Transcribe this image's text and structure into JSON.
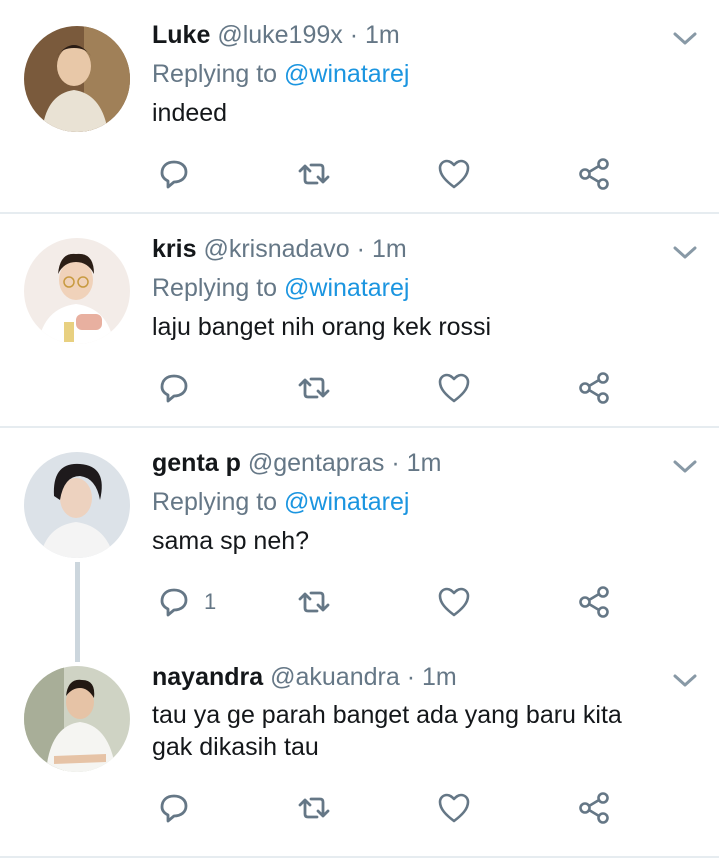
{
  "tweets": [
    {
      "name": "Luke",
      "handle": "@luke199x",
      "time": "1m",
      "replying_prefix": "Replying to",
      "replying_to": "@winatarej",
      "text": "indeed",
      "reply_count": ""
    },
    {
      "name": "kris",
      "handle": "@krisnadavo",
      "time": "1m",
      "replying_prefix": "Replying to",
      "replying_to": "@winatarej",
      "text": "laju banget nih orang kek rossi",
      "reply_count": ""
    },
    {
      "name": "genta p",
      "handle": "@gentapras",
      "time": "1m",
      "replying_prefix": "Replying to",
      "replying_to": "@winatarej",
      "text": "sama sp neh?",
      "reply_count": "1"
    },
    {
      "name": "nayandra",
      "handle": "@akuandra",
      "time": "1m",
      "text_line1": "tau ya ge parah banget ada yang baru kita",
      "text_line2": "gak dikasih tau",
      "reply_count": ""
    }
  ],
  "separator": "·",
  "icons": [
    "chevron-down-icon",
    "reply-icon",
    "retweet-icon",
    "like-icon",
    "share-icon"
  ],
  "colors": {
    "name": "#14171a",
    "meta": "#657786",
    "mention": "#1b95e0",
    "divider": "#e6ecf0",
    "thread_line": "#ccd6dd"
  }
}
